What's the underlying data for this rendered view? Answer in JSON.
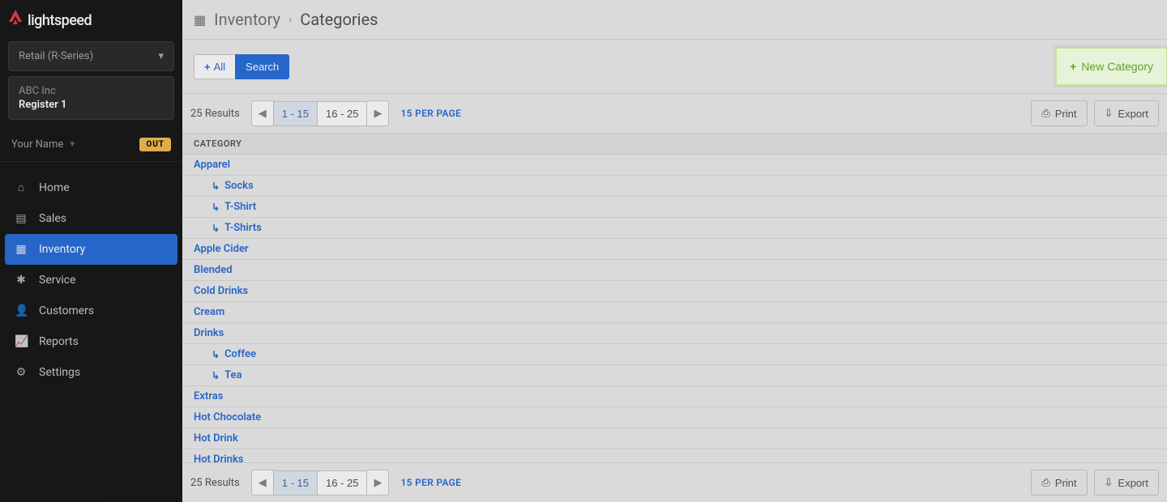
{
  "brand": "lightspeed",
  "store_selector": {
    "label": "Retail (R-Series)"
  },
  "store_info": {
    "company": "ABC Inc",
    "register": "Register 1"
  },
  "user": {
    "name": "Your Name",
    "status": "OUT"
  },
  "nav": [
    {
      "icon": "home-icon",
      "glyph": "⌂",
      "label": "Home",
      "active": false
    },
    {
      "icon": "sales-icon",
      "glyph": "▤",
      "label": "Sales",
      "active": false
    },
    {
      "icon": "inventory-icon",
      "glyph": "▦",
      "label": "Inventory",
      "active": true
    },
    {
      "icon": "service-icon",
      "glyph": "✱",
      "label": "Service",
      "active": false
    },
    {
      "icon": "customers-icon",
      "glyph": "👤",
      "label": "Customers",
      "active": false
    },
    {
      "icon": "reports-icon",
      "glyph": "📈",
      "label": "Reports",
      "active": false
    },
    {
      "icon": "settings-icon",
      "glyph": "⚙",
      "label": "Settings",
      "active": false
    }
  ],
  "breadcrumb": {
    "icon": "▦",
    "parent": "Inventory",
    "current": "Categories"
  },
  "toolbar": {
    "all_label": "All",
    "search_label": "Search",
    "new_label": "New Category"
  },
  "pager": {
    "results": "25 Results",
    "pages": [
      "1 - 15",
      "16 - 25"
    ],
    "active_page_index": 0,
    "per_page": "15 PER PAGE",
    "print": "Print",
    "export": "Export"
  },
  "table": {
    "header": "CATEGORY",
    "rows": [
      {
        "label": "Apparel",
        "child": false
      },
      {
        "label": "Socks",
        "child": true
      },
      {
        "label": "T-Shirt",
        "child": true
      },
      {
        "label": "T-Shirts",
        "child": true
      },
      {
        "label": "Apple Cider",
        "child": false
      },
      {
        "label": "Blended",
        "child": false
      },
      {
        "label": "Cold Drinks",
        "child": false
      },
      {
        "label": "Cream",
        "child": false
      },
      {
        "label": "Drinks",
        "child": false
      },
      {
        "label": "Coffee",
        "child": true
      },
      {
        "label": "Tea",
        "child": true
      },
      {
        "label": "Extras",
        "child": false
      },
      {
        "label": "Hot Chocolate",
        "child": false
      },
      {
        "label": "Hot Drink",
        "child": false
      },
      {
        "label": "Hot Drinks",
        "child": false
      }
    ]
  }
}
